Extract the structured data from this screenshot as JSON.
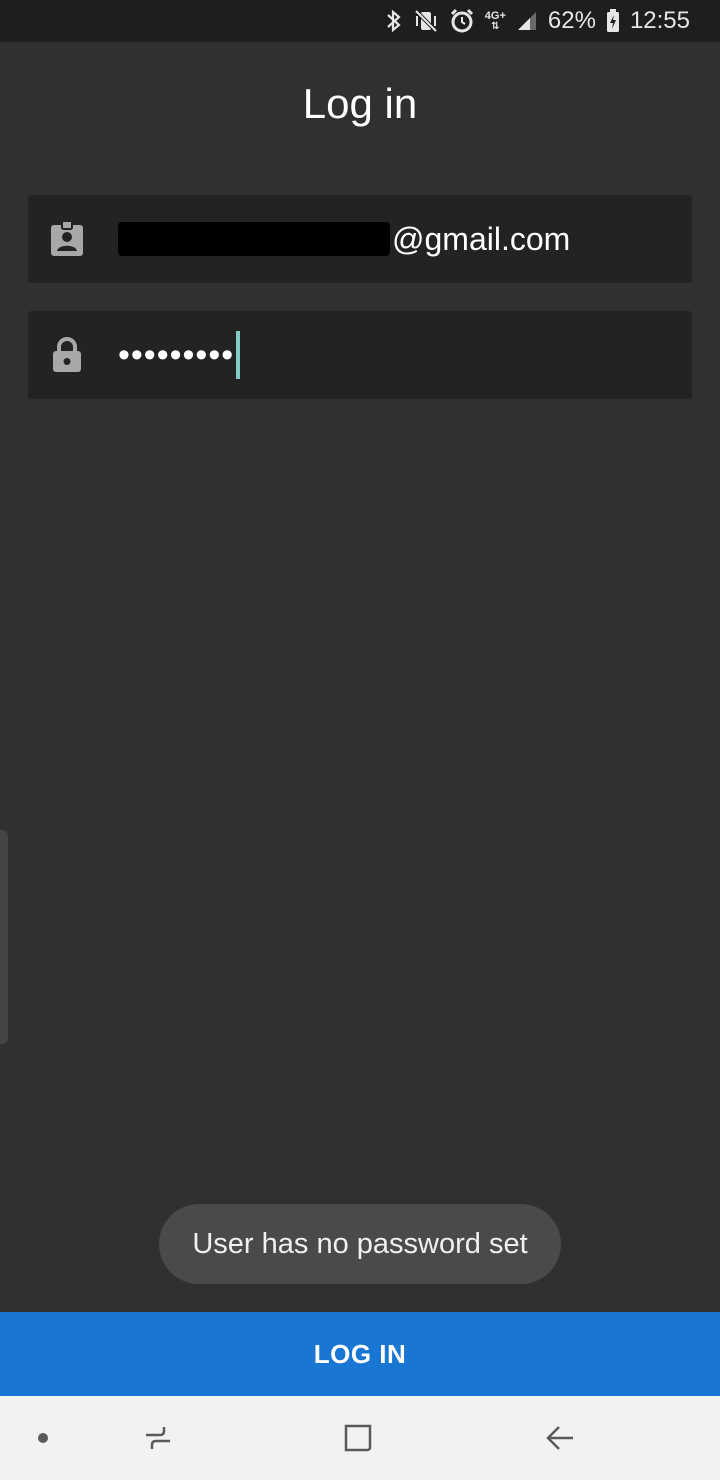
{
  "status_bar": {
    "icons": [
      "bluetooth-icon",
      "vibrate-mute-icon",
      "alarm-icon",
      "network-4g-icon",
      "signal-icon",
      "battery-icon"
    ],
    "network_label": "4G+",
    "battery": "62%",
    "time": "12:55"
  },
  "page": {
    "title": "Log in"
  },
  "form": {
    "email": {
      "icon": "contact-badge-icon",
      "value_suffix": "@gmail.com"
    },
    "password": {
      "icon": "lock-icon",
      "masked_value": "•••••••••"
    }
  },
  "toast": {
    "message": "User has no password set"
  },
  "actions": {
    "login_label": "LOG IN"
  },
  "nav_bar": {
    "items": [
      "dot-icon",
      "recent-apps-icon",
      "home-icon",
      "back-icon"
    ]
  },
  "colors": {
    "background": "#303030",
    "field": "#232323",
    "accent": "#1976d2",
    "cursor": "#80cbc4"
  }
}
